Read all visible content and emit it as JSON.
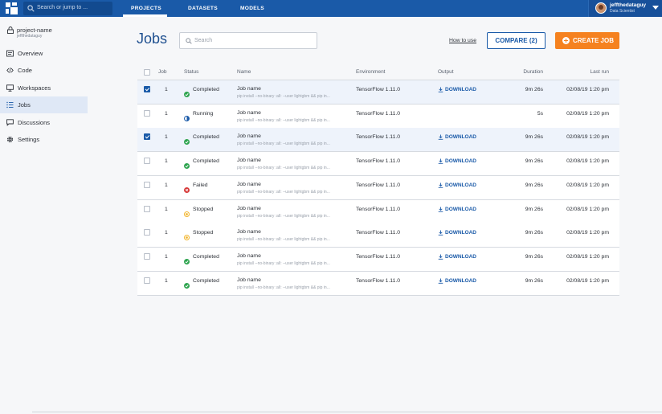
{
  "topbar": {
    "search_placeholder": "Search or jump to ...",
    "tabs": [
      {
        "label": "PROJECTS",
        "active": true
      },
      {
        "label": "DATASETS",
        "active": false
      },
      {
        "label": "MODELS",
        "active": false
      }
    ],
    "user": {
      "name": "jeffthedataguy",
      "role": "Data Scientist"
    }
  },
  "sidebar": {
    "project_name": "project-name",
    "project_owner": "jeffthedataguy",
    "items": [
      {
        "label": "Overview",
        "icon": "overview-icon",
        "active": false
      },
      {
        "label": "Code",
        "icon": "code-icon",
        "active": false
      },
      {
        "label": "Workspaces",
        "icon": "monitor-icon",
        "active": false
      },
      {
        "label": "Jobs",
        "icon": "jobs-list-icon",
        "active": true
      },
      {
        "label": "Discussions",
        "icon": "chat-icon",
        "active": false
      },
      {
        "label": "Settings",
        "icon": "gear-icon",
        "active": false
      }
    ]
  },
  "main": {
    "title": "Jobs",
    "search_placeholder": "Search",
    "how_to_use": "How to use",
    "compare_label": "COMPARE (2)",
    "create_label": "CREATE JOB"
  },
  "colors": {
    "brand": "#1a5aa8",
    "accent": "#f5821f",
    "completed": "#2ea44f",
    "running": "#1a5aa8",
    "failed": "#d73a3a",
    "stopped": "#f2b630"
  },
  "table": {
    "headers": {
      "job": "Job",
      "status": "Status",
      "name": "Name",
      "environment": "Environment",
      "output": "Output",
      "duration": "Duration",
      "last_run": "Last run"
    },
    "rows": [
      {
        "selected": true,
        "job": "1",
        "status": "Completed",
        "name": "Job name",
        "cmd": "pip install --no-binary :all: --user lightgbm && pip in...",
        "env": "TensorFlow 1.11.0",
        "output": "DOWNLOAD",
        "duration": "9m 26s",
        "last_run": "02/08/19 1:20 pm"
      },
      {
        "selected": false,
        "job": "1",
        "status": "Running",
        "name": "Job name",
        "cmd": "pip install --no-binary :all: --user lightgbm && pip in...",
        "env": "TensorFlow 1.11.0",
        "output": "",
        "duration": "5s",
        "last_run": "02/08/19 1:20 pm"
      },
      {
        "selected": true,
        "job": "1",
        "status": "Completed",
        "name": "Job name",
        "cmd": "pip install --no-binary :all: --user lightgbm && pip in...",
        "env": "TensorFlow 1.11.0",
        "output": "DOWNLOAD",
        "duration": "9m 26s",
        "last_run": "02/08/19 1:20 pm"
      },
      {
        "selected": false,
        "job": "1",
        "status": "Completed",
        "name": "Job name",
        "cmd": "pip install --no-binary :all: --user lightgbm && pip in...",
        "env": "TensorFlow 1.11.0",
        "output": "DOWNLOAD",
        "duration": "9m 26s",
        "last_run": "02/08/19 1:20 pm"
      },
      {
        "selected": false,
        "job": "1",
        "status": "Failed",
        "name": "Job name",
        "cmd": "pip install --no-binary :all: --user lightgbm && pip in...",
        "env": "TensorFlow 1.11.0",
        "output": "DOWNLOAD",
        "duration": "9m 26s",
        "last_run": "02/08/19 1:20 pm"
      },
      {
        "selected": false,
        "job": "1",
        "status": "Stopped",
        "name": "Job name",
        "cmd": "pip install --no-binary :all: --user lightgbm && pip in...",
        "env": "TensorFlow 1.11.0",
        "output": "DOWNLOAD",
        "duration": "9m 26s",
        "last_run": "02/08/19 1:20 pm"
      },
      {
        "selected": false,
        "job": "1",
        "status": "Stopped",
        "name": "Job name",
        "cmd": "pip install --no-binary :all: --user lightgbm && pip in...",
        "env": "TensorFlow 1.11.0",
        "output": "DOWNLOAD",
        "duration": "9m 26s",
        "last_run": "02/08/19 1:20 pm"
      },
      {
        "selected": false,
        "job": "1",
        "status": "Completed",
        "name": "Job name",
        "cmd": "pip install --no-binary :all: --user lightgbm && pip in...",
        "env": "TensorFlow 1.11.0",
        "output": "DOWNLOAD",
        "duration": "9m 26s",
        "last_run": "02/08/19 1:20 pm"
      },
      {
        "selected": false,
        "job": "1",
        "status": "Completed",
        "name": "Job name",
        "cmd": "pip install --no-binary :all: --user lightgbm && pip in...",
        "env": "TensorFlow 1.11.0",
        "output": "DOWNLOAD",
        "duration": "9m 26s",
        "last_run": "02/08/19 1:20 pm"
      }
    ]
  }
}
